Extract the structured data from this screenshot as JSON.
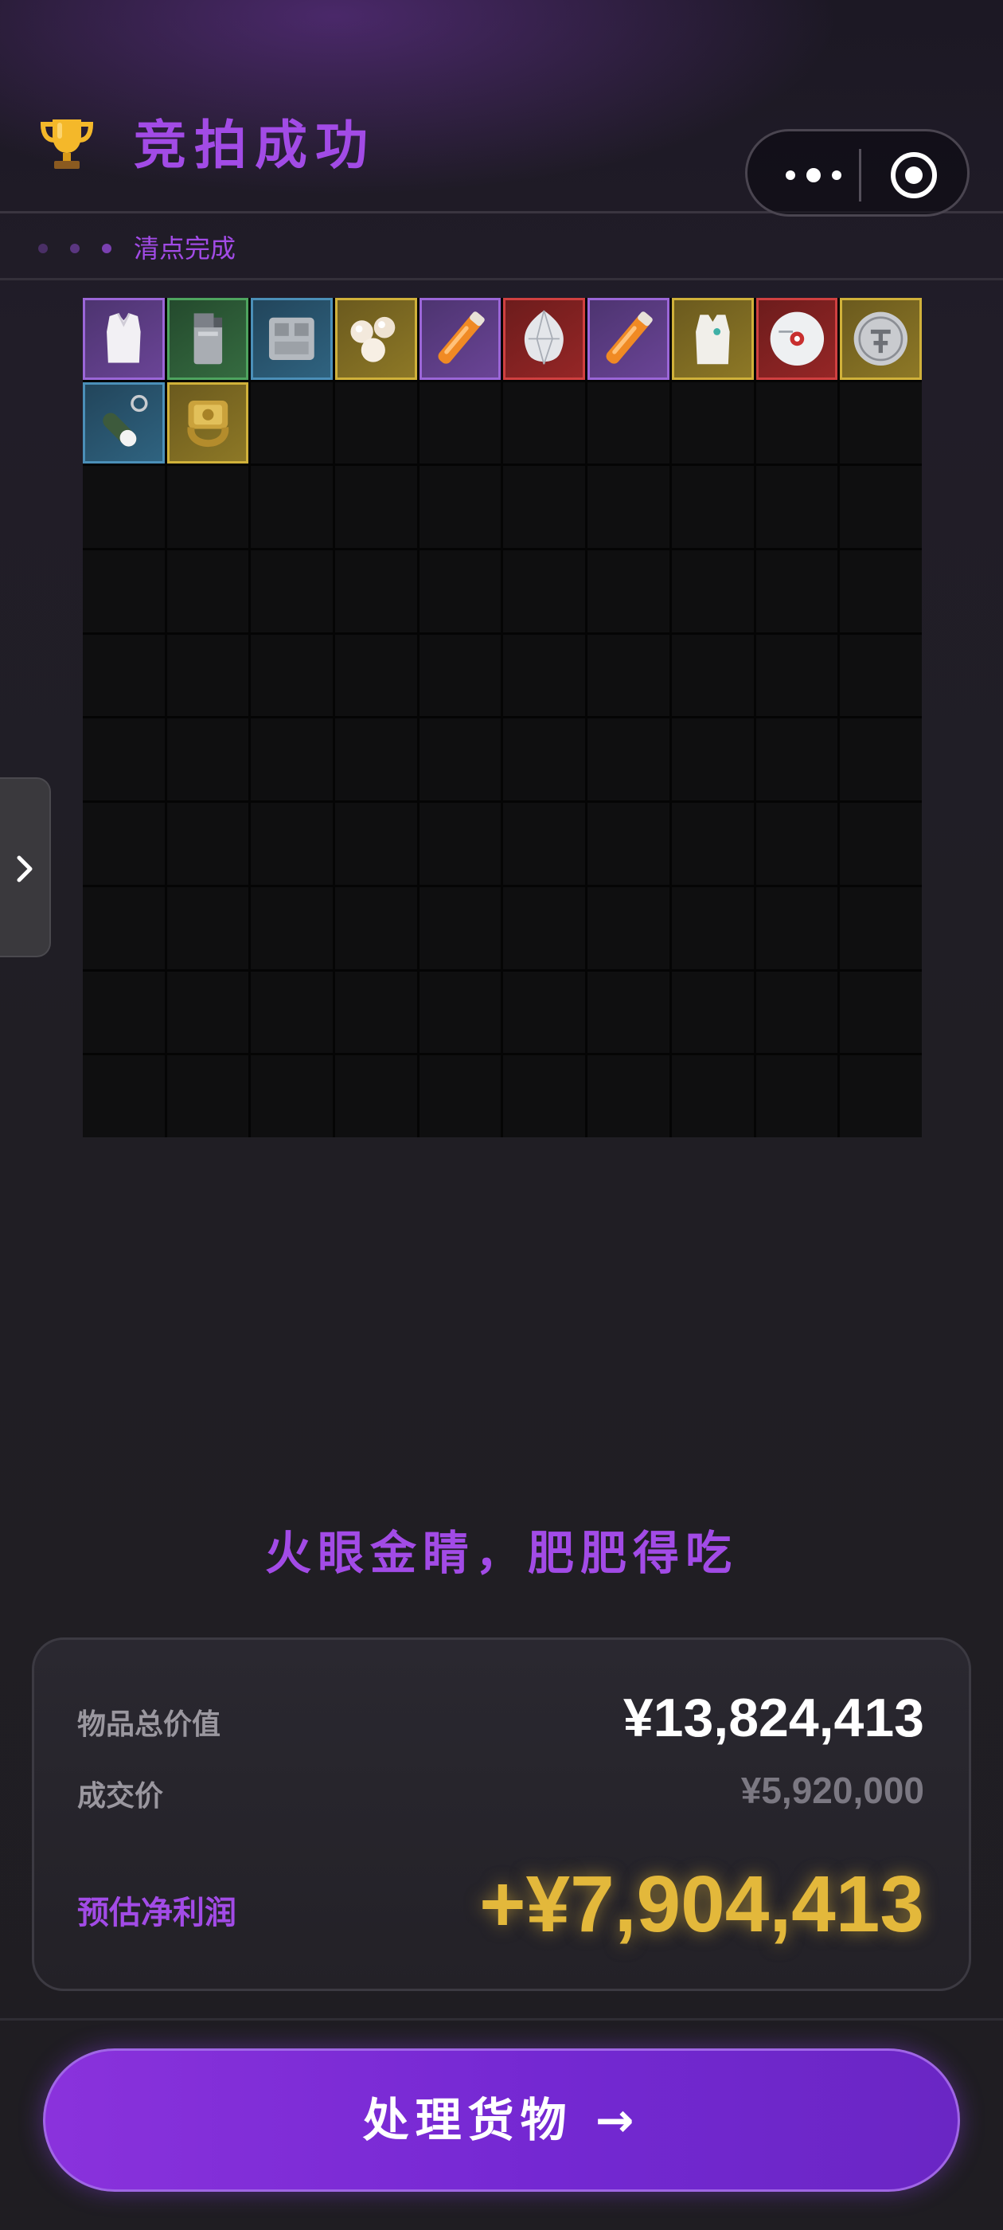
{
  "header": {
    "title": "竞拍成功",
    "trophy_icon": "trophy-icon",
    "capsule": {
      "more_icon": "more-dots-icon",
      "close_icon": "target-circle-icon"
    }
  },
  "substatus": {
    "label": "清点完成"
  },
  "inventory": {
    "columns": 10,
    "rows": 10,
    "items": [
      {
        "name": "armor-vest-icon",
        "rarity": "purple"
      },
      {
        "name": "lighter-icon",
        "rarity": "green"
      },
      {
        "name": "machine-box-icon",
        "rarity": "blue"
      },
      {
        "name": "pearls-icon",
        "rarity": "gold"
      },
      {
        "name": "tube-icon",
        "rarity": "purple"
      },
      {
        "name": "diamond-icon",
        "rarity": "red"
      },
      {
        "name": "tube-icon",
        "rarity": "purple"
      },
      {
        "name": "white-vest-icon",
        "rarity": "gold"
      },
      {
        "name": "disc-icon",
        "rarity": "red"
      },
      {
        "name": "coin-icon",
        "rarity": "gold"
      },
      {
        "name": "capsule-keychain-icon",
        "rarity": "blue"
      },
      {
        "name": "gold-ring-icon",
        "rarity": "gold"
      }
    ],
    "rarity_colors": {
      "purple": "#9b66d8",
      "green": "#4ea45f",
      "blue": "#4b8fb8",
      "gold": "#d0b13a",
      "red": "#d04040"
    }
  },
  "side_tab": {
    "icon": "chevron-right-icon"
  },
  "slogan": "火眼金睛，肥肥得吃",
  "summary": {
    "total_label": "物品总价值",
    "total_value": "¥13,824,413",
    "deal_label": "成交价",
    "deal_value": "¥5,920,000",
    "profit_label": "预估净利润",
    "profit_value": "+¥7,904,413"
  },
  "cta": {
    "label": "处理货物 →"
  },
  "colors": {
    "accent": "#a24be6",
    "gold": "#e3b83b",
    "background": "#201e24"
  }
}
